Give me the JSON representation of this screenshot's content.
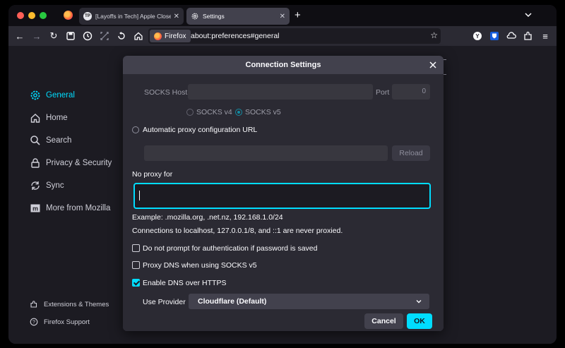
{
  "tabs": [
    {
      "label": "[Layoffs in Tech] Apple Close to",
      "favicon_text": "TP"
    },
    {
      "label": "Settings"
    }
  ],
  "nav": {
    "identity_label": "Firefox",
    "url": "about:preferences#general"
  },
  "sidebar": {
    "items": [
      {
        "label": "General",
        "icon": "gear-icon",
        "active": true
      },
      {
        "label": "Home",
        "icon": "home-icon"
      },
      {
        "label": "Search",
        "icon": "search-icon"
      },
      {
        "label": "Privacy & Security",
        "icon": "lock-icon"
      },
      {
        "label": "Sync",
        "icon": "sync-icon"
      },
      {
        "label": "More from Mozilla",
        "icon": "mozilla-icon"
      }
    ],
    "footer": [
      {
        "label": "Extensions & Themes",
        "icon": "puzzle-icon"
      },
      {
        "label": "Firefox Support",
        "icon": "help-icon"
      }
    ]
  },
  "dialog": {
    "title": "Connection Settings",
    "socks_host_label": "SOCKS Host",
    "port_label": "Port",
    "port_value": "0",
    "socks_v4_label": "SOCKS v4",
    "socks_v5_label": "SOCKS v5",
    "auto_proxy_label": "Automatic proxy configuration URL",
    "reload_label": "Reload",
    "no_proxy_label": "No proxy for",
    "no_proxy_value": "",
    "example_text": "Example: .mozilla.org, .net.nz, 192.168.1.0/24",
    "localhost_note": "Connections to localhost, 127.0.0.1/8, and ::1 are never proxied.",
    "no_auth_prompt_label": "Do not prompt for authentication if password is saved",
    "proxy_dns_label": "Proxy DNS when using SOCKS v5",
    "dns_https_label": "Enable DNS over HTTPS",
    "provider_label": "Use Provider",
    "provider_value": "Cloudflare (Default)",
    "cancel_label": "Cancel",
    "ok_label": "OK"
  },
  "colors": {
    "accent": "#00ddff",
    "dialog_bg": "#2b2a33",
    "page_bg": "#1c1b22"
  }
}
